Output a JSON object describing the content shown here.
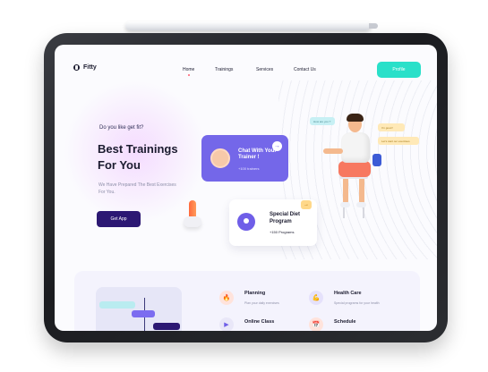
{
  "brand": {
    "name": "Fitty"
  },
  "nav": {
    "items": [
      {
        "label": "Home",
        "active": true
      },
      {
        "label": "Trainings",
        "active": false
      },
      {
        "label": "Services",
        "active": false
      },
      {
        "label": "Contact Us",
        "active": false
      }
    ],
    "profile_label": "Profile"
  },
  "hero": {
    "eyebrow": "Do you like get fit?",
    "headline": "Best Trainings For You",
    "description": "We Have Prepared The Best Exercises For You.",
    "cta_label": "Get App"
  },
  "cards": {
    "chat": {
      "title": "Chat With Your Trainer !",
      "subtitle": "+100 trainers",
      "arrow": "→"
    },
    "diet": {
      "title": "Special Diet Program",
      "subtitle": "+150 Programs",
      "arrow": "→"
    }
  },
  "bubbles": {
    "b1": "How are you ?",
    "b2": "I'm good !",
    "b3": "Let's start our exercises"
  },
  "features": [
    {
      "title": "Planning",
      "subtitle": "Plan your daily exercises",
      "icon": "fire-icon",
      "color": "#ffe3dc",
      "glyph": "🔥"
    },
    {
      "title": "Health Care",
      "subtitle": "Special programs for your health",
      "icon": "bicep-icon",
      "color": "#e5e1fb",
      "glyph": "💪"
    },
    {
      "title": "Online Class",
      "subtitle": "",
      "icon": "play-icon",
      "color": "#e9e7f8",
      "glyph": "▶"
    },
    {
      "title": "Schedule",
      "subtitle": "",
      "icon": "calendar-icon",
      "color": "#ffe3dc",
      "glyph": "📅"
    }
  ],
  "colors": {
    "accent": "#2ae0c9",
    "primary": "#2c1873",
    "card_violet": "#7467e9",
    "text": "#1b1b2f"
  }
}
